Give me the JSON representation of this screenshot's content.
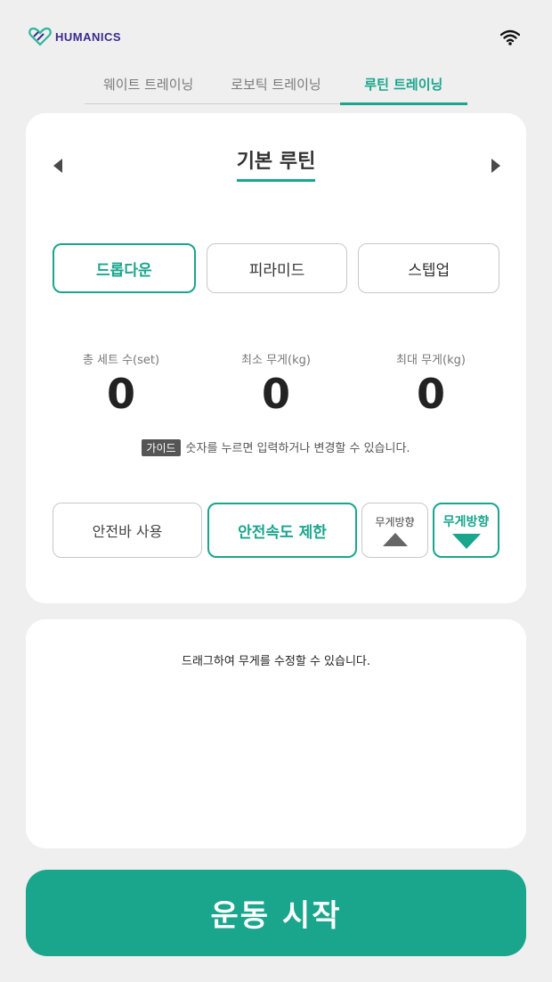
{
  "header": {
    "logo_text": "HUMANICS",
    "logo_icon": "heart-logo-icon",
    "status_icon": "wifi-icon"
  },
  "tabs": [
    {
      "label": "웨이트 트레이닝",
      "active": false
    },
    {
      "label": "로보틱 트레이닝",
      "active": false
    },
    {
      "label": "루틴 트레이닝",
      "active": true
    }
  ],
  "routine": {
    "title": "기본 루틴",
    "prev_icon": "caret-left-icon",
    "next_icon": "caret-right-icon"
  },
  "modes": [
    {
      "label": "드롭다운",
      "active": true
    },
    {
      "label": "피라미드",
      "active": false
    },
    {
      "label": "스텝업",
      "active": false
    }
  ],
  "stats": [
    {
      "label": "총 세트 수(set)",
      "value": "0"
    },
    {
      "label": "최소 무게(kg)",
      "value": "0"
    },
    {
      "label": "최대 무게(kg)",
      "value": "0"
    }
  ],
  "guide": {
    "badge": "가이드",
    "text": "숫자를 누르면 입력하거나 변경할 수 있습니다."
  },
  "options": {
    "safety_bar": "안전바 사용",
    "safety_speed": "안전속도 제한",
    "weight_dir_up": "무게방향",
    "weight_dir_down": "무게방향"
  },
  "graph": {
    "hint": "드래그하여 무게를 수정할 수 있습니다."
  },
  "start_button": "운동 시작",
  "colors": {
    "accent": "#1aa58d",
    "background": "#efefef",
    "card": "#ffffff"
  }
}
